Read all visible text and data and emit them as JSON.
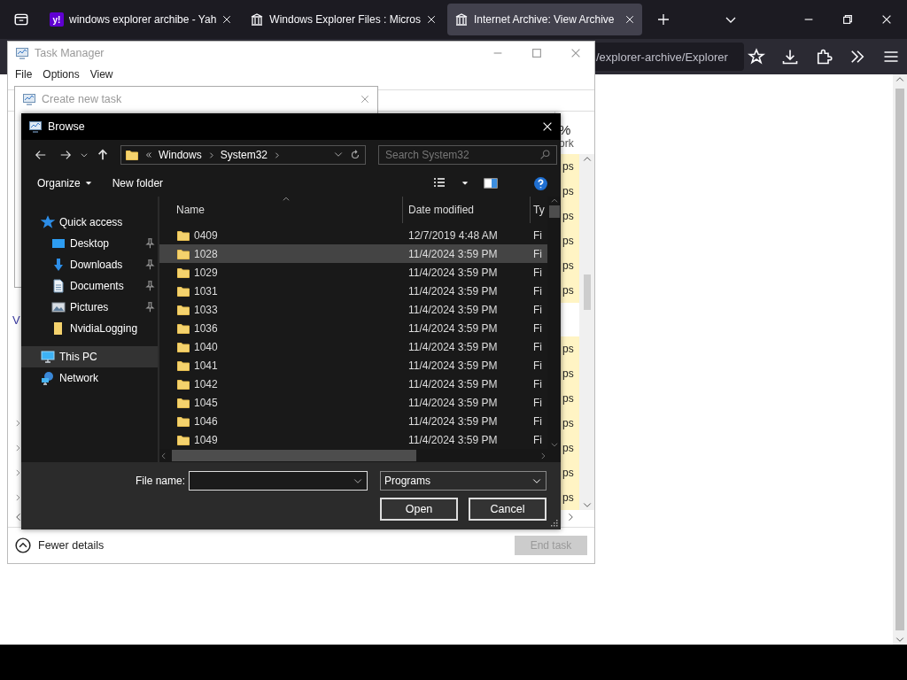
{
  "browser": {
    "tabs": [
      {
        "title": "windows explorer archibe - Yah",
        "kind": "yahoo",
        "icon_text": "y!",
        "selected": false
      },
      {
        "title": "Windows Explorer Files : Micros",
        "kind": "archive",
        "selected": false
      },
      {
        "title": "Internet Archive: View Archive",
        "kind": "archive",
        "selected": true
      }
    ],
    "url": "/explorer-archive/Explorer"
  },
  "task_manager": {
    "title": "Task Manager",
    "menu": [
      "File",
      "Options",
      "View"
    ],
    "header_fragments": [
      "%",
      "ork"
    ],
    "rows": [
      {
        "kind": "row",
        "text": "ps"
      },
      {
        "kind": "row",
        "text": "ps"
      },
      {
        "kind": "row",
        "text": "ps"
      },
      {
        "kind": "row",
        "text": "ps"
      },
      {
        "kind": "row",
        "text": "ps"
      },
      {
        "kind": "row",
        "text": "ps"
      },
      {
        "kind": "group",
        "label": "V"
      },
      {
        "kind": "row",
        "text": "ps"
      },
      {
        "kind": "row",
        "text": "ps"
      },
      {
        "kind": "row",
        "text": "ps"
      },
      {
        "kind": "expandable",
        "text": "ps"
      },
      {
        "kind": "expandable",
        "text": "ps"
      },
      {
        "kind": "expandable",
        "text": "ps"
      },
      {
        "kind": "expandable",
        "text": "ps"
      }
    ],
    "details_toggle": "Fewer details",
    "end_task": {
      "label": "End task",
      "disabled": true
    }
  },
  "create_task_dialog": {
    "title": "Create new task"
  },
  "browse_dialog": {
    "title": "Browse",
    "breadcrumb": [
      "Windows",
      "System32"
    ],
    "search_placeholder": "Search System32",
    "organize": "Organize",
    "new_folder": "New folder",
    "nav": [
      {
        "label": "Quick access",
        "kind": "quick_access",
        "pinned": false,
        "selected": false,
        "children": [
          {
            "label": "Desktop",
            "kind": "desktop",
            "pinned": true,
            "selected": false
          },
          {
            "label": "Downloads",
            "kind": "downloads",
            "pinned": true,
            "selected": false
          },
          {
            "label": "Documents",
            "kind": "documents",
            "pinned": true,
            "selected": false
          },
          {
            "label": "Pictures",
            "kind": "pictures",
            "pinned": true,
            "selected": false
          },
          {
            "label": "NvidiaLogging",
            "kind": "folder",
            "pinned": false,
            "selected": false
          }
        ]
      },
      {
        "label": "This PC",
        "kind": "pc",
        "pinned": false,
        "selected": true
      },
      {
        "label": "Network",
        "kind": "network",
        "pinned": false,
        "selected": false
      }
    ],
    "columns": [
      "Name",
      "Date modified",
      "Ty"
    ],
    "rows": [
      {
        "name": "0409",
        "date": "12/7/2019 4:48 AM",
        "type": "Fi",
        "selected": false
      },
      {
        "name": "1028",
        "date": "11/4/2024 3:59 PM",
        "type": "Fi",
        "selected": true
      },
      {
        "name": "1029",
        "date": "11/4/2024 3:59 PM",
        "type": "Fi",
        "selected": false
      },
      {
        "name": "1031",
        "date": "11/4/2024 3:59 PM",
        "type": "Fi",
        "selected": false
      },
      {
        "name": "1033",
        "date": "11/4/2024 3:59 PM",
        "type": "Fi",
        "selected": false
      },
      {
        "name": "1036",
        "date": "11/4/2024 3:59 PM",
        "type": "Fi",
        "selected": false
      },
      {
        "name": "1040",
        "date": "11/4/2024 3:59 PM",
        "type": "Fi",
        "selected": false
      },
      {
        "name": "1041",
        "date": "11/4/2024 3:59 PM",
        "type": "Fi",
        "selected": false
      },
      {
        "name": "1042",
        "date": "11/4/2024 3:59 PM",
        "type": "Fi",
        "selected": false
      },
      {
        "name": "1045",
        "date": "11/4/2024 3:59 PM",
        "type": "Fi",
        "selected": false
      },
      {
        "name": "1046",
        "date": "11/4/2024 3:59 PM",
        "type": "Fi",
        "selected": false
      },
      {
        "name": "1049",
        "date": "11/4/2024 3:59 PM",
        "type": "Fi",
        "selected": false
      }
    ],
    "file_name_label": "File name:",
    "filter": "Programs",
    "buttons": [
      "Open",
      "Cancel"
    ]
  }
}
